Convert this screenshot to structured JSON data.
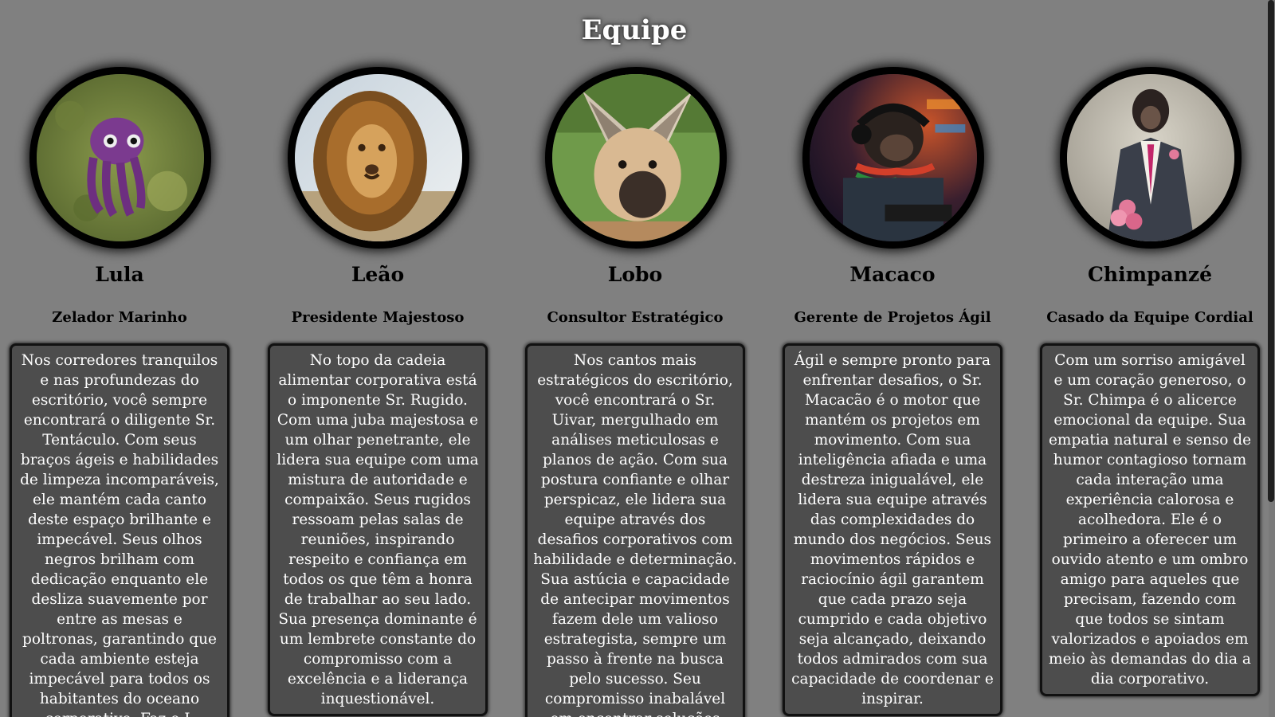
{
  "page": {
    "title": "Equipe"
  },
  "members": [
    {
      "name": "Lula",
      "role": "Zelador Marinho",
      "icon": "squid-photo",
      "bio": "Nos corredores tranquilos e nas profundezas do escritório, você sempre encontrará o diligente Sr. Tentáculo. Com seus braços ágeis e habilidades de limpeza incomparáveis, ele mantém cada canto deste espaço brilhante e impecável. Seus olhos negros brilham com dedicação enquanto ele desliza suavemente por entre as mesas e poltronas, garantindo que cada ambiente esteja impecável para todos os habitantes do oceano corporativo. Faz o L"
    },
    {
      "name": "Leão",
      "role": "Presidente Majestoso",
      "icon": "lion-photo",
      "bio": "No topo da cadeia alimentar corporativa está o imponente Sr. Rugido. Com uma juba majestosa e um olhar penetrante, ele lidera sua equipe com uma mistura de autoridade e compaixão. Seus rugidos ressoam pelas salas de reuniões, inspirando respeito e confiança em todos os que têm a honra de trabalhar ao seu lado. Sua presença dominante é um lembrete constante do compromisso com a excelência e a liderança inquestionável."
    },
    {
      "name": "Lobo",
      "role": "Consultor Estratégico",
      "icon": "maned-wolf-photo",
      "bio": "Nos cantos mais estratégicos do escritório, você encontrará o Sr. Uivar, mergulhado em análises meticulosas e planos de ação. Com sua postura confiante e olhar perspicaz, ele lidera sua equipe através dos desafios corporativos com habilidade e determinação. Sua astúcia e capacidade de antecipar movimentos fazem dele um valioso estrategista, sempre um passo à frente na busca pelo sucesso. Seu compromisso inabalável em encontrar soluções inovadoras e eficazes torna-o uma peça fundamental no tabuleiro do mundo empresarial, inspirando"
    },
    {
      "name": "Macaco",
      "role": "Gerente de Projetos Ágil",
      "icon": "monkey-dj-photo",
      "bio": "Ágil e sempre pronto para enfrentar desafios, o Sr. Macacão é o motor que mantém os projetos em movimento. Com sua inteligência afiada e uma destreza inigualável, ele lidera sua equipe através das complexidades do mundo dos negócios. Seus movimentos rápidos e raciocínio ágil garantem que cada prazo seja cumprido e cada objetivo seja alcançado, deixando todos admirados com sua capacidade de coordenar e inspirar."
    },
    {
      "name": "Chimpanzé",
      "role": "Casado da Equipe Cordial",
      "icon": "chimpanzee-suit-photo",
      "bio": "Com um sorriso amigável e um coração generoso, o Sr. Chimpa é o alicerce emocional da equipe. Sua empatia natural e senso de humor contagioso tornam cada interação uma experiência calorosa e acolhedora. Ele é o primeiro a oferecer um ouvido atento e um ombro amigo para aqueles que precisam, fazendo com que todos se sintam valorizados e apoiados em meio às demandas do dia a dia corporativo."
    }
  ]
}
